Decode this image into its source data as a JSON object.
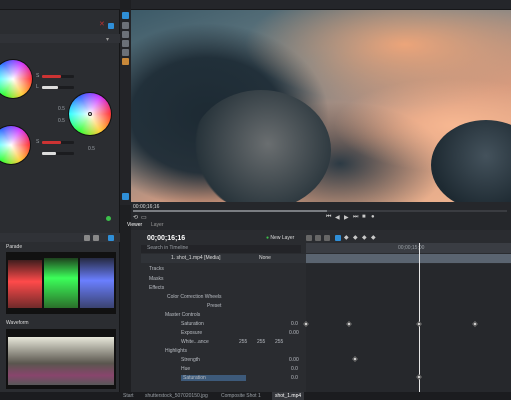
{
  "viewer": {
    "timecode": "00:00;16;16",
    "tab_viewer": "Viewer",
    "tab_layer": "Layer"
  },
  "timeline": {
    "timecode": "00;00;16;16",
    "new_layer": "New Layer",
    "search_placeholder": "Search in Timeline",
    "ruler_mark": "00;00;15;00",
    "layer_name": "1. shot_1.mp4 [Media]",
    "blend_mode": "None",
    "rows": [
      "Tracks",
      "Masks",
      "Effects",
      "Color Correction Wheels",
      "Preset",
      "Master Controls",
      "Saturation",
      "Exposure",
      "White...ance",
      "Highlights",
      "Strength",
      "Hue",
      "Saturation"
    ],
    "values": {
      "saturation": "0.0",
      "exposure": "0.00",
      "wb1": "255",
      "wb2": "255",
      "wb3": "255",
      "strength": "0.00",
      "hue": "0.0",
      "hl_saturation": "0.0"
    }
  },
  "scopes": {
    "parade_label": "Parade",
    "waveform_label": "Waveform"
  },
  "wheels": {
    "val_a": "0.5",
    "val_b": "0.5",
    "val_c": "0.5"
  },
  "bottom_tabs": [
    "Start",
    "shutterstock_507020150.jpg",
    "Composite Shot 1",
    "shot_1.mp4"
  ],
  "colors": {
    "accent": "#2f8fd8",
    "panel": "#2b2d31",
    "keyframe": "#e8e8e8",
    "green": "#3cc04a"
  }
}
